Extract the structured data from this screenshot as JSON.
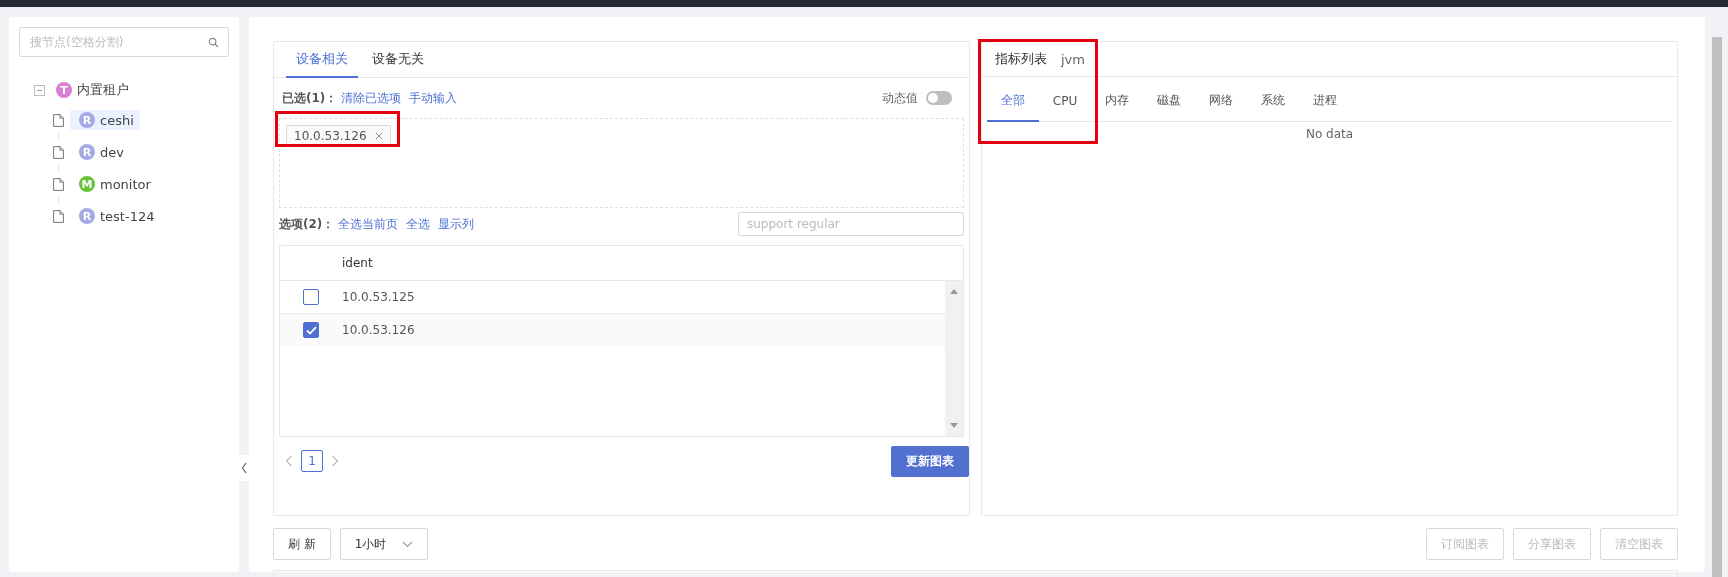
{
  "sidebar": {
    "search": {
      "placeholder": "搜节点(空格分割)"
    },
    "tree": [
      {
        "label": "内置租户",
        "badge": "T",
        "color": "#dc7fd3",
        "expanded": true,
        "selected": false,
        "children": [
          {
            "label": "ceshi",
            "badge": "R",
            "color": "#a5a8e6",
            "selected": true
          },
          {
            "label": "dev",
            "badge": "R",
            "color": "#a5a8e6",
            "selected": false
          },
          {
            "label": "monitor",
            "badge": "M",
            "color": "#67c23a",
            "selected": false
          },
          {
            "label": "test-124",
            "badge": "R",
            "color": "#a5a8e6",
            "selected": false
          }
        ]
      }
    ]
  },
  "device_panel": {
    "tabs": [
      {
        "label": "设备相关",
        "selected": true
      },
      {
        "label": "设备无关",
        "selected": false
      }
    ],
    "selected_label": "已选(1)：",
    "selected_actions": [
      "清除已选项",
      "手动输入"
    ],
    "dynamic_toggle": {
      "label": "动态值",
      "on": false
    },
    "selected_tags": [
      {
        "label": "10.0.53.126",
        "highlighted": true
      }
    ],
    "options_label": "选项(2)：",
    "option_actions": [
      "全选当前页",
      "全选",
      "显示列"
    ],
    "filter": {
      "placeholder": "support regular"
    },
    "table": {
      "columns": [
        "ident"
      ],
      "rows": [
        {
          "ident": "10.0.53.125",
          "checked": false
        },
        {
          "ident": "10.0.53.126",
          "checked": true
        }
      ]
    },
    "pages": [
      {
        "label": "1",
        "selected": true
      }
    ],
    "update_button": "更新图表"
  },
  "metric_panel": {
    "title": "指标列表",
    "subtitle": "jvm",
    "highlighted": true,
    "tabs": [
      {
        "label": "全部",
        "selected": true
      },
      {
        "label": "CPU",
        "selected": false
      },
      {
        "label": "内存",
        "selected": false
      },
      {
        "label": "磁盘",
        "selected": false
      },
      {
        "label": "网络",
        "selected": false
      },
      {
        "label": "系统",
        "selected": false
      },
      {
        "label": "进程",
        "selected": false
      }
    ],
    "empty_text": "No data"
  },
  "toolbar": {
    "refresh_button": "刷 新",
    "range": {
      "value": "1小时"
    },
    "actions": [
      {
        "label": "订阅图表",
        "disabled": true
      },
      {
        "label": "分享图表",
        "disabled": true
      },
      {
        "label": "清空图表",
        "disabled": true
      }
    ]
  }
}
